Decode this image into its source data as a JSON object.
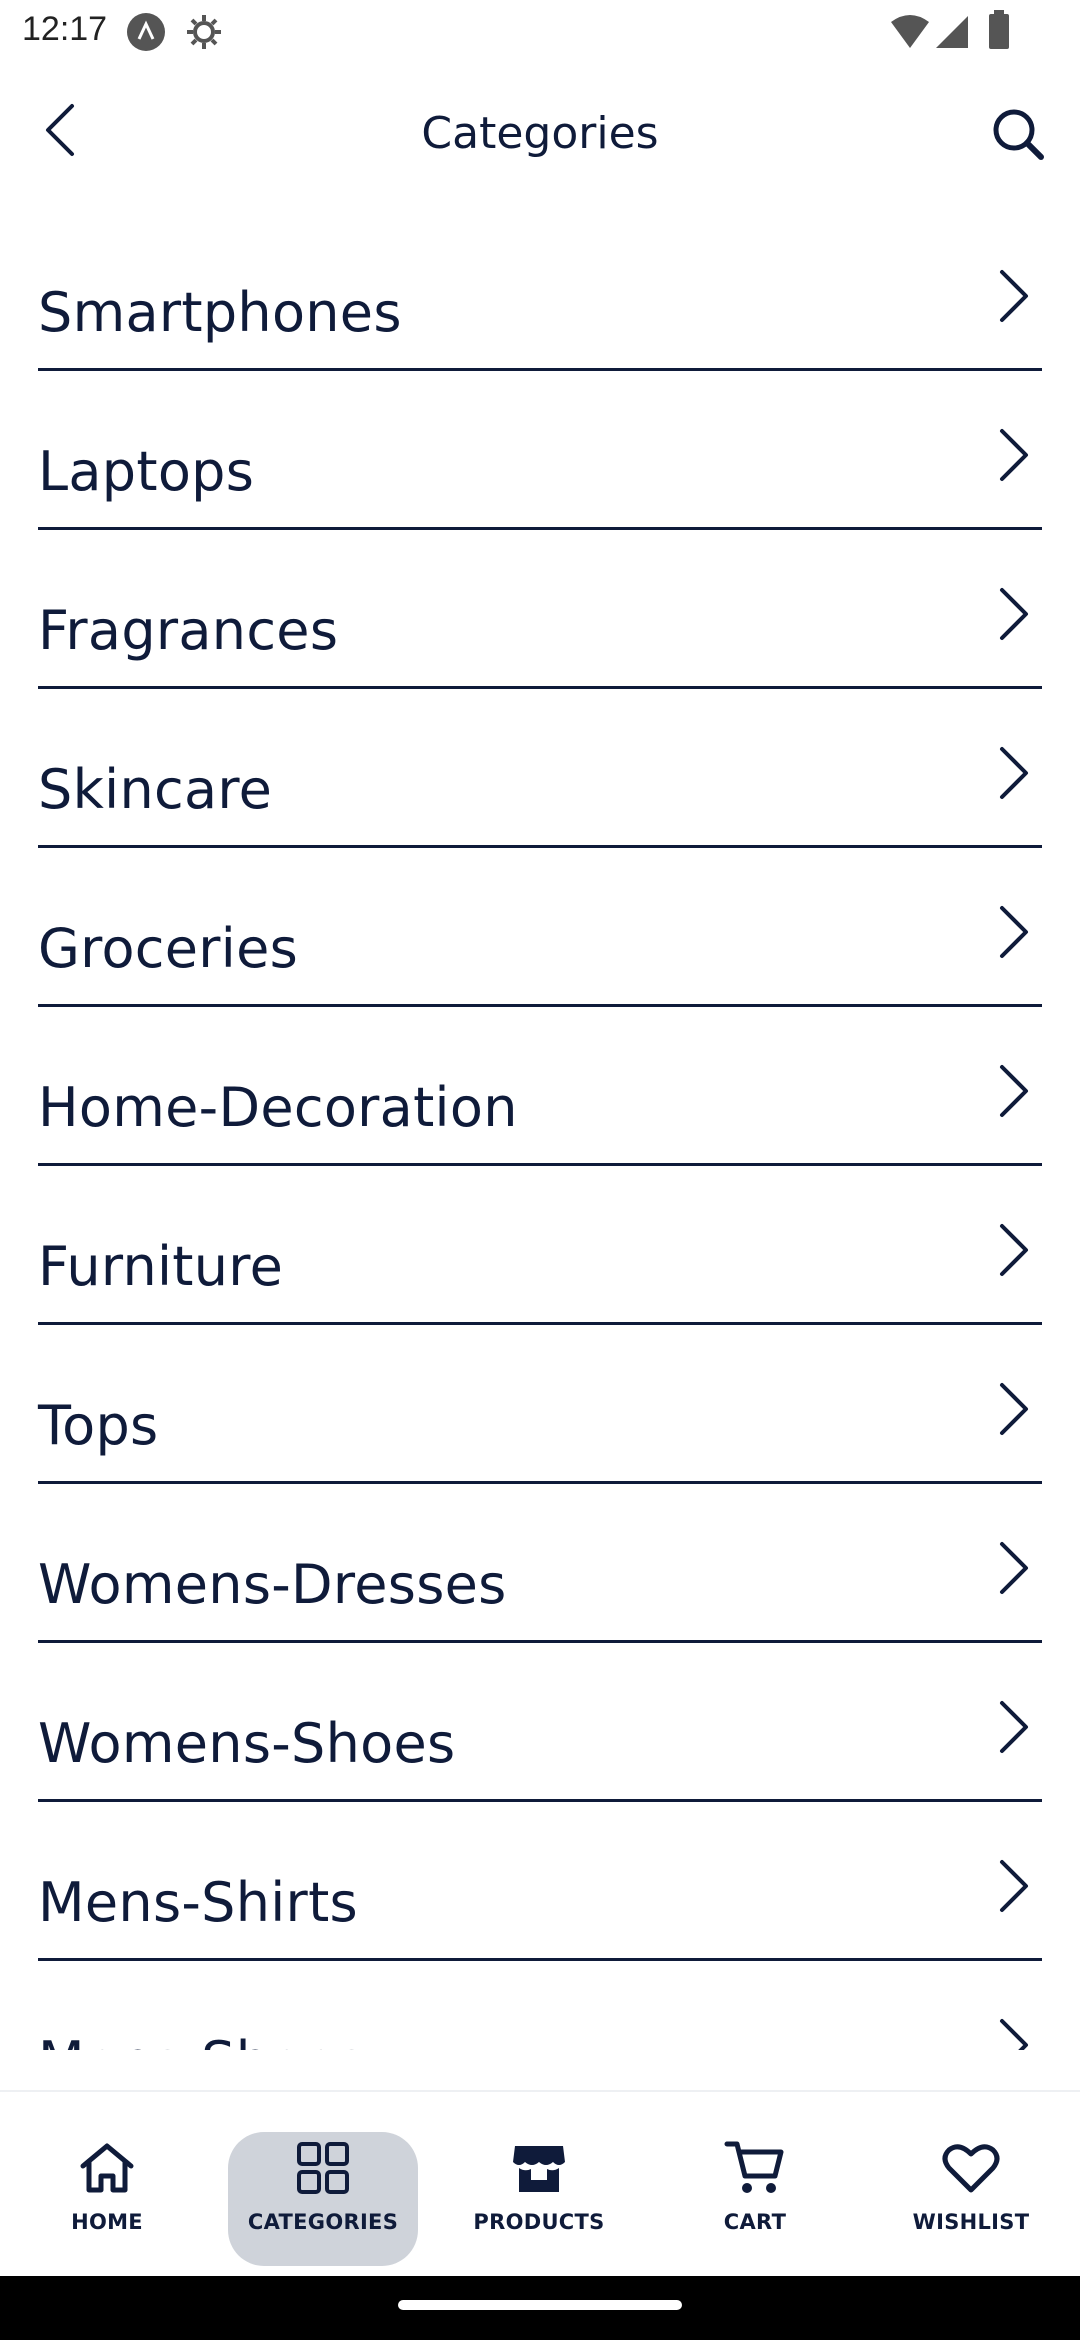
{
  "status_bar": {
    "time": "12:17",
    "icons": [
      "app-notification-icon",
      "settings-notification-icon",
      "wifi-icon",
      "signal-icon",
      "battery-icon"
    ]
  },
  "app_bar": {
    "title": "Categories",
    "back_icon": "chevron-left-icon",
    "search_icon": "search-icon"
  },
  "categories": [
    {
      "label": "Smartphones"
    },
    {
      "label": "Laptops"
    },
    {
      "label": "Fragrances"
    },
    {
      "label": "Skincare"
    },
    {
      "label": "Groceries"
    },
    {
      "label": "Home-Decoration"
    },
    {
      "label": "Furniture"
    },
    {
      "label": "Tops"
    },
    {
      "label": "Womens-Dresses"
    },
    {
      "label": "Womens-Shoes"
    },
    {
      "label": "Mens-Shirts"
    },
    {
      "label": "Mens-Shoes"
    }
  ],
  "bottom_nav": {
    "items": [
      {
        "label": "HOME",
        "icon": "home-icon"
      },
      {
        "label": "CATEGORIES",
        "icon": "grid-icon",
        "active": true
      },
      {
        "label": "PRODUCTS",
        "icon": "store-icon"
      },
      {
        "label": "CART",
        "icon": "cart-icon"
      },
      {
        "label": "WISHLIST",
        "icon": "heart-icon"
      }
    ]
  },
  "colors": {
    "text": "#0f1b3a",
    "active_nav_bg": "#cfd3da",
    "background": "#ffffff"
  }
}
